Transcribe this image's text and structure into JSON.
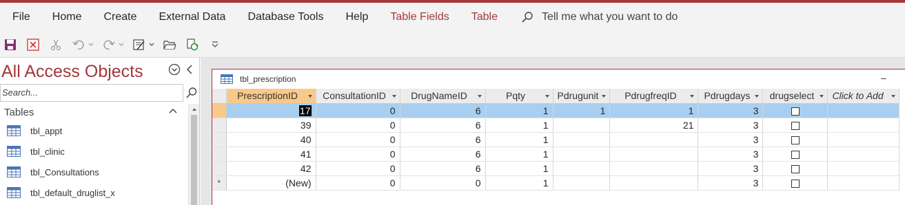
{
  "ribbon": {
    "tabs": [
      "File",
      "Home",
      "Create",
      "External Data",
      "Database Tools",
      "Help"
    ],
    "context_tabs": [
      "Table Fields",
      "Table"
    ],
    "tell_me": "Tell me what you want to do",
    "context_color": "#a4373a"
  },
  "qat": {
    "icons": [
      "save-icon",
      "close-database-icon",
      "cut-icon",
      "undo-icon",
      "redo-icon",
      "view-icon",
      "open-folder-icon",
      "refresh-icon",
      "customize-qat-icon"
    ]
  },
  "nav": {
    "title": "All Access Objects",
    "search_placeholder": "Search...",
    "group": "Tables",
    "items": [
      "tbl_appt",
      "tbl_clinic",
      "tbl_Consultations",
      "tbl_default_druglist_x"
    ]
  },
  "document": {
    "title": "tbl_prescription",
    "minimize": "–",
    "columns": [
      "PrescriptionID",
      "ConsultationID",
      "DrugNameID",
      "Pqty",
      "Pdrugunit",
      "PdrugfreqID",
      "Pdrugdays",
      "drugselect",
      "Click to Add"
    ],
    "rows": [
      {
        "PrescriptionID": "17",
        "ConsultationID": "0",
        "DrugNameID": "6",
        "Pqty": "1",
        "Pdrugunit": "1",
        "PdrugfreqID": "1",
        "Pdrugdays": "3",
        "drugselect": false,
        "current": true
      },
      {
        "PrescriptionID": "39",
        "ConsultationID": "0",
        "DrugNameID": "6",
        "Pqty": "1",
        "Pdrugunit": "",
        "PdrugfreqID": "21",
        "Pdrugdays": "3",
        "drugselect": false
      },
      {
        "PrescriptionID": "40",
        "ConsultationID": "0",
        "DrugNameID": "6",
        "Pqty": "1",
        "Pdrugunit": "",
        "PdrugfreqID": "",
        "Pdrugdays": "3",
        "drugselect": false
      },
      {
        "PrescriptionID": "41",
        "ConsultationID": "0",
        "DrugNameID": "6",
        "Pqty": "1",
        "Pdrugunit": "",
        "PdrugfreqID": "",
        "Pdrugdays": "3",
        "drugselect": false
      },
      {
        "PrescriptionID": "42",
        "ConsultationID": "0",
        "DrugNameID": "6",
        "Pqty": "1",
        "Pdrugunit": "",
        "PdrugfreqID": "",
        "Pdrugdays": "3",
        "drugselect": false
      }
    ],
    "new_row": {
      "marker": "*",
      "PrescriptionID": "(New)",
      "ConsultationID": "0",
      "DrugNameID": "0",
      "Pqty": "1",
      "Pdrugunit": "",
      "PdrugfreqID": "",
      "Pdrugdays": "3",
      "drugselect": false
    }
  }
}
